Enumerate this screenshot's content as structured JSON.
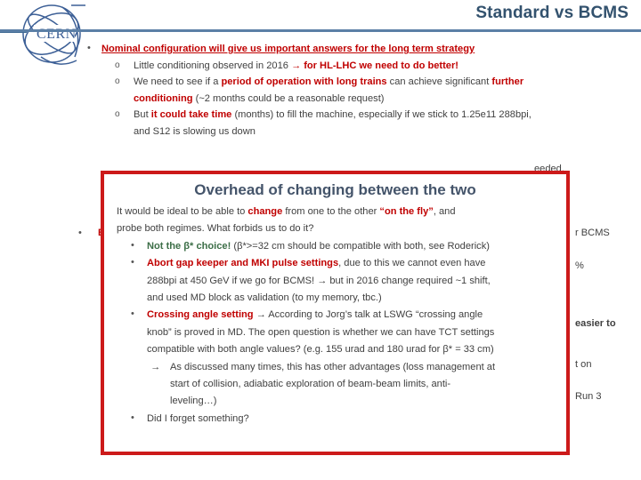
{
  "header": {
    "title": "Standard vs BCMS",
    "title_color": "#33526e",
    "rule_color": "#5b7fa6",
    "logo_label": "CERN"
  },
  "slide_body": {
    "bullet1": {
      "marker": "•",
      "text": "Nominal configuration will give us important answers for the long term strategy"
    },
    "sub_items": [
      {
        "marker": "o",
        "parts": [
          {
            "text": "Little conditioning observed in 2016 ",
            "style": "plain"
          },
          {
            "text": "→ for HL-LHC we need to do better!",
            "style": "red-bold"
          }
        ]
      },
      {
        "marker": "o",
        "parts": [
          {
            "text": "We need to see if a ",
            "style": "plain"
          },
          {
            "text": "period of operation with long trains",
            "style": "red-bold"
          },
          {
            "text": " can achieve significant ",
            "style": "plain"
          },
          {
            "text": "further",
            "style": "red-bold"
          }
        ]
      },
      {
        "marker": "",
        "parts": [
          {
            "text": "conditioning",
            "style": "red-bold"
          },
          {
            "text": " (~2 months could be a reasonable request)",
            "style": "plain"
          }
        ]
      },
      {
        "marker": "o",
        "parts": [
          {
            "text": "But ",
            "style": "plain"
          },
          {
            "text": "it could take time",
            "style": "red-bold"
          },
          {
            "text": " (months) to fill the machine, especially if we stick to 1.25e11 288bpi,",
            "style": "plain"
          }
        ]
      },
      {
        "marker": "",
        "parts": [
          {
            "text": "and S12 is slowing us down",
            "style": "plain"
          }
        ]
      }
    ],
    "occluded_fragments": {
      "line_partially_hidden_right": "eeded,",
      "bullet2_left_fragment": "BC",
      "right_col_fragments": [
        "r BCMS",
        "%",
        "easier to",
        "t on",
        "Run 3"
      ]
    }
  },
  "overlay": {
    "border_color": "#cc1a1a",
    "title": "Overhead of changing between the two",
    "title_color": "#44546a",
    "intro_lines": [
      [
        {
          "text": "It would be ideal to be able to ",
          "style": "plain"
        },
        {
          "text": "change",
          "style": "red-bold"
        },
        {
          "text": " from one to the other ",
          "style": "plain"
        },
        {
          "text": "“on the fly”",
          "style": "red-bold"
        },
        {
          "text": ", and",
          "style": "plain"
        }
      ],
      [
        {
          "text": "probe both regimes. What forbids us to do it?",
          "style": "plain"
        }
      ]
    ],
    "bullets": [
      {
        "marker": "•",
        "lines": [
          [
            {
              "text": "Not the β* choice!",
              "style": "green-bold"
            },
            {
              "text": " (β*>=32 cm should be compatible with both, see Roderick)",
              "style": "plain"
            }
          ]
        ]
      },
      {
        "marker": "•",
        "lines": [
          [
            {
              "text": "Abort gap keeper and MKI pulse settings",
              "style": "red-bold"
            },
            {
              "text": ", due to this we cannot even have",
              "style": "plain"
            }
          ],
          [
            {
              "text": "288bpi at 450 GeV if we go for BCMS! → but in 2016 change required ~1 shift,",
              "style": "plain"
            }
          ],
          [
            {
              "text": "and used MD block as validation (to my memory, tbc.)",
              "style": "plain"
            }
          ]
        ]
      },
      {
        "marker": "•",
        "lines": [
          [
            {
              "text": "Crossing angle setting",
              "style": "red-bold"
            },
            {
              "text": " → According to Jorg’s talk at LSWG “crossing angle",
              "style": "plain"
            }
          ],
          [
            {
              "text": "knob” is proved in MD. The open question is whether we can have TCT settings",
              "style": "plain"
            }
          ],
          [
            {
              "text": "compatible with both angle values? (e.g. 155 urad and 180 urad for β* = 33 cm)",
              "style": "plain"
            }
          ]
        ]
      }
    ],
    "sub_arrow": {
      "marker": "→",
      "lines": [
        "As discussed many times, this has other advantages (loss management at",
        "start of collision, adiabatic exploration of beam-beam limits, anti-",
        "leveling…)"
      ]
    },
    "last_bullet": {
      "marker": "•",
      "text": "Did I forget something?"
    }
  }
}
